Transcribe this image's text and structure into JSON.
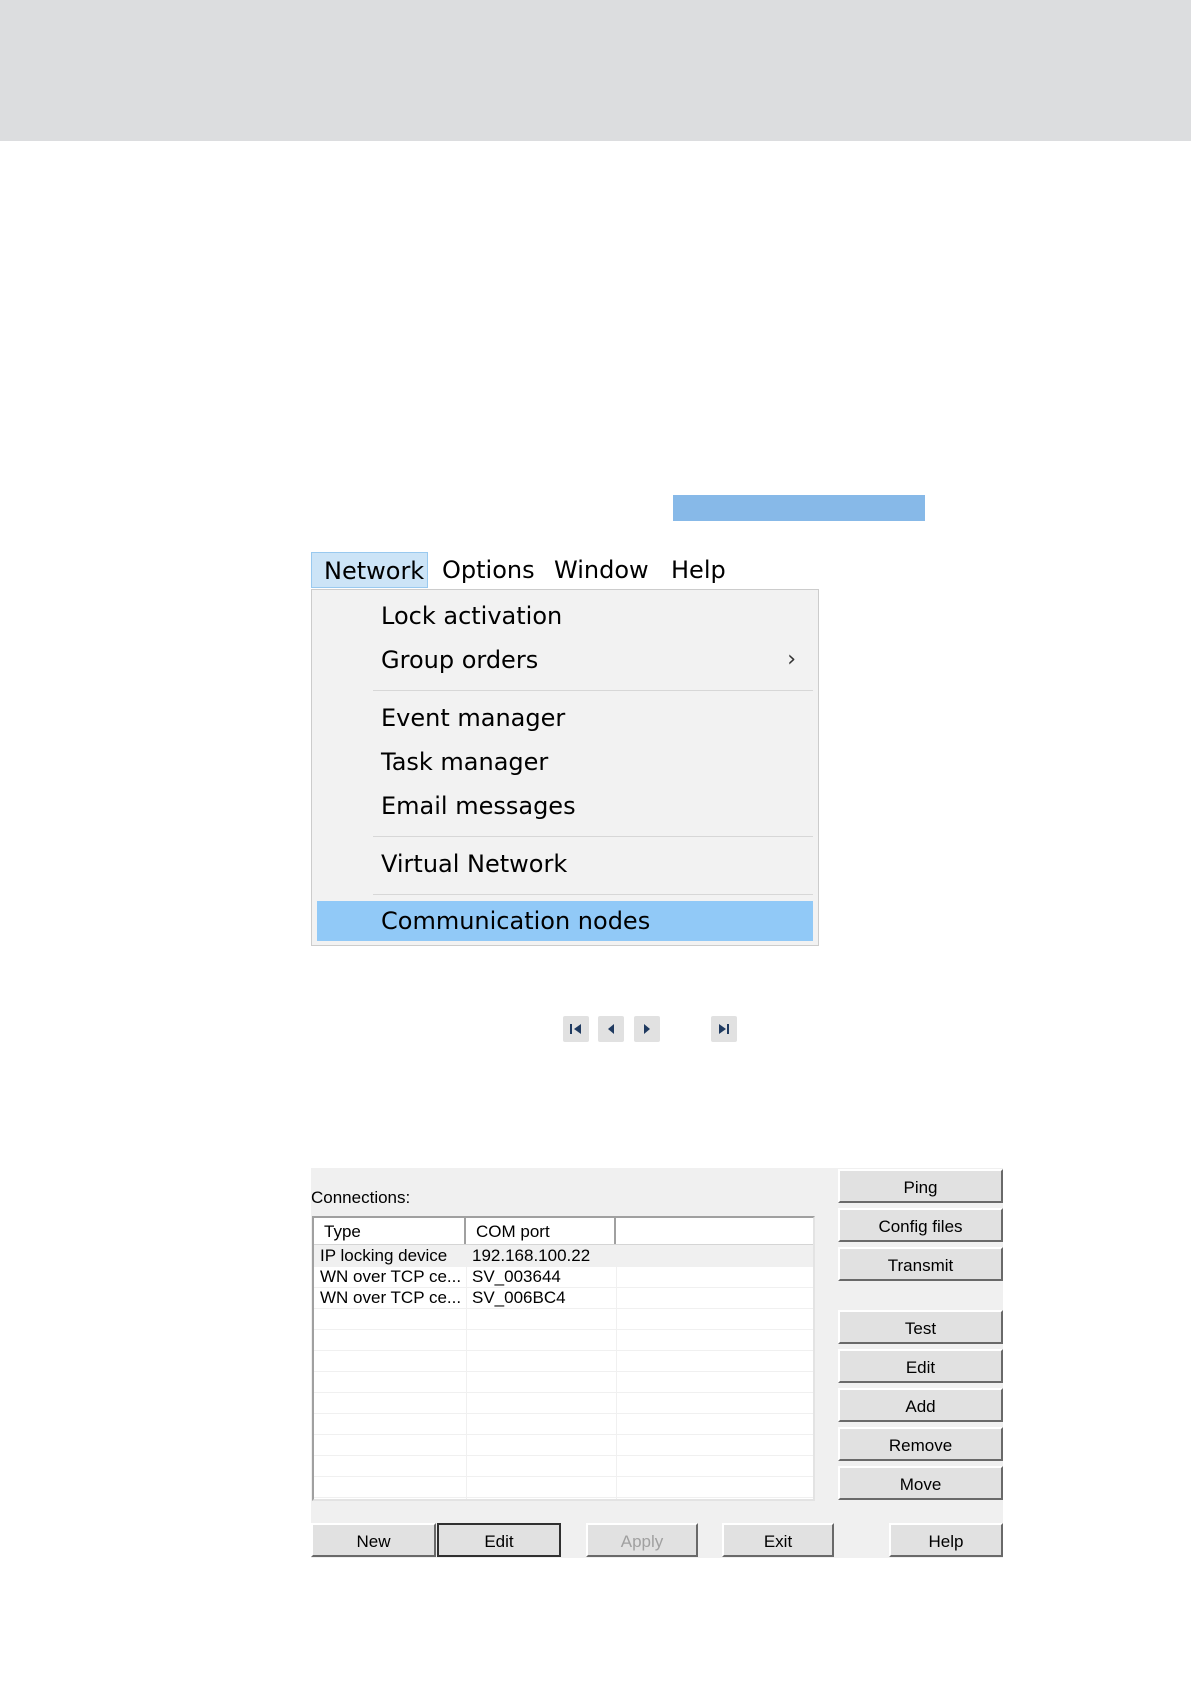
{
  "menubar": {
    "items": [
      "Network",
      "Options",
      "Window",
      "Help"
    ]
  },
  "dropdown": {
    "items": [
      "Lock activation",
      "Group orders",
      "Event manager",
      "Task manager",
      "Email messages",
      "Virtual Network",
      "Communication nodes"
    ],
    "submenu_arrow": "›"
  },
  "nav_buttons": [
    "first-record-icon",
    "previous-record-icon",
    "next-record-icon",
    "last-record-icon"
  ],
  "dialog": {
    "label": "Connections:",
    "columns": [
      "Type",
      "COM port",
      ""
    ],
    "rows": [
      [
        "IP locking device",
        "192.168.100.22"
      ],
      [
        "WN over TCP ce...",
        "SV_003644"
      ],
      [
        "WN over TCP ce...",
        "SV_006BC4"
      ]
    ],
    "side_buttons": [
      "Ping",
      "Config files",
      "Transmit",
      "Test",
      "Edit",
      "Add",
      "Remove",
      "Move"
    ],
    "bottom_buttons": [
      "New",
      "Edit",
      "Apply",
      "Exit",
      "Help"
    ]
  },
  "colors": {
    "highlight": "#91c9f7",
    "menubar_active": "#cce4f7",
    "blue_bar": "#87b9e8",
    "header_band": "#dcdddf"
  }
}
